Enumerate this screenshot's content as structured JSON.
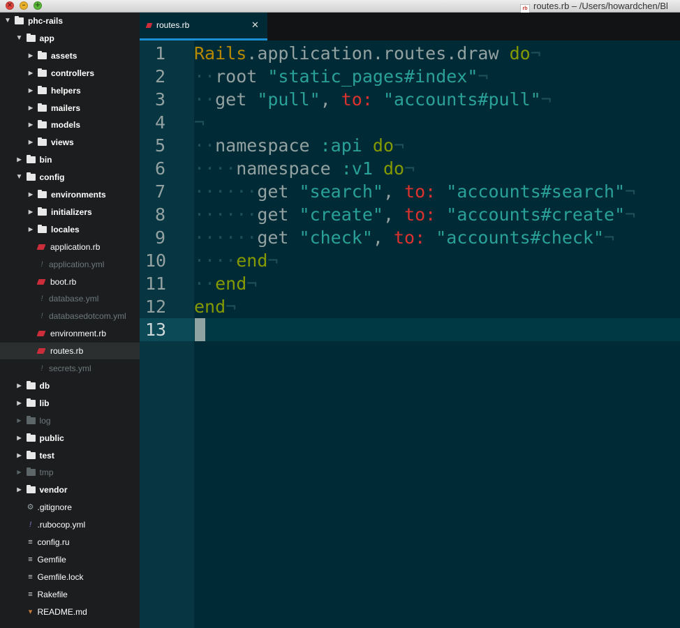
{
  "window": {
    "title": "routes.rb – /Users/howardchen/Bl",
    "title_icon": "rb"
  },
  "sidebar": {
    "items": [
      {
        "label": "phc-rails",
        "depth": 0,
        "kind": "dir",
        "expanded": true
      },
      {
        "label": "app",
        "depth": 1,
        "kind": "dir",
        "expanded": true
      },
      {
        "label": "assets",
        "depth": 2,
        "kind": "dir",
        "expanded": false
      },
      {
        "label": "controllers",
        "depth": 2,
        "kind": "dir",
        "expanded": false
      },
      {
        "label": "helpers",
        "depth": 2,
        "kind": "dir",
        "expanded": false
      },
      {
        "label": "mailers",
        "depth": 2,
        "kind": "dir",
        "expanded": false
      },
      {
        "label": "models",
        "depth": 2,
        "kind": "dir",
        "expanded": false
      },
      {
        "label": "views",
        "depth": 2,
        "kind": "dir",
        "expanded": false
      },
      {
        "label": "bin",
        "depth": 1,
        "kind": "dir",
        "expanded": false
      },
      {
        "label": "config",
        "depth": 1,
        "kind": "dir",
        "expanded": true
      },
      {
        "label": "environments",
        "depth": 2,
        "kind": "dir",
        "expanded": false
      },
      {
        "label": "initializers",
        "depth": 2,
        "kind": "dir",
        "expanded": false
      },
      {
        "label": "locales",
        "depth": 2,
        "kind": "dir",
        "expanded": false
      },
      {
        "label": "application.rb",
        "depth": 2,
        "kind": "ruby"
      },
      {
        "label": "application.yml",
        "depth": 2,
        "kind": "yml",
        "dim": true
      },
      {
        "label": "boot.rb",
        "depth": 2,
        "kind": "ruby"
      },
      {
        "label": "database.yml",
        "depth": 2,
        "kind": "yml",
        "dim": true
      },
      {
        "label": "databasedotcom.yml",
        "depth": 2,
        "kind": "yml",
        "dim": true
      },
      {
        "label": "environment.rb",
        "depth": 2,
        "kind": "ruby"
      },
      {
        "label": "routes.rb",
        "depth": 2,
        "kind": "ruby",
        "selected": true
      },
      {
        "label": "secrets.yml",
        "depth": 2,
        "kind": "yml",
        "dim": true
      },
      {
        "label": "db",
        "depth": 1,
        "kind": "dir",
        "expanded": false
      },
      {
        "label": "lib",
        "depth": 1,
        "kind": "dir",
        "expanded": false
      },
      {
        "label": "log",
        "depth": 1,
        "kind": "dir",
        "expanded": false,
        "dim": true
      },
      {
        "label": "public",
        "depth": 1,
        "kind": "dir",
        "expanded": false
      },
      {
        "label": "test",
        "depth": 1,
        "kind": "dir",
        "expanded": false
      },
      {
        "label": "tmp",
        "depth": 1,
        "kind": "dir",
        "expanded": false,
        "dim": true
      },
      {
        "label": "vendor",
        "depth": 1,
        "kind": "dir",
        "expanded": false
      },
      {
        "label": ".gitignore",
        "depth": 1,
        "kind": "gear"
      },
      {
        "label": ".rubocop.yml",
        "depth": 1,
        "kind": "yml-bright"
      },
      {
        "label": "config.ru",
        "depth": 1,
        "kind": "text"
      },
      {
        "label": "Gemfile",
        "depth": 1,
        "kind": "text"
      },
      {
        "label": "Gemfile.lock",
        "depth": 1,
        "kind": "text"
      },
      {
        "label": "Rakefile",
        "depth": 1,
        "kind": "text"
      },
      {
        "label": "README.md",
        "depth": 1,
        "kind": "markdown"
      }
    ]
  },
  "tabs": [
    {
      "label": "routes.rb",
      "active": true
    }
  ],
  "editor": {
    "current_line": 13,
    "lines": [
      {
        "n": "1",
        "indent": 0,
        "tokens": [
          {
            "t": "Rails",
            "c": "const"
          },
          {
            "t": ".application.routes.draw ",
            "c": "plain"
          },
          {
            "t": "do",
            "c": "kw"
          }
        ]
      },
      {
        "n": "2",
        "indent": 1,
        "tokens": [
          {
            "t": "root ",
            "c": "plain"
          },
          {
            "t": "\"static_pages#index\"",
            "c": "str"
          }
        ]
      },
      {
        "n": "3",
        "indent": 1,
        "tokens": [
          {
            "t": "get ",
            "c": "plain"
          },
          {
            "t": "\"pull\"",
            "c": "str"
          },
          {
            "t": ", ",
            "c": "plain"
          },
          {
            "t": "to:",
            "c": "key"
          },
          {
            "t": " ",
            "c": "plain"
          },
          {
            "t": "\"accounts#pull\"",
            "c": "str"
          }
        ]
      },
      {
        "n": "4",
        "indent": 0,
        "tokens": []
      },
      {
        "n": "5",
        "indent": 1,
        "tokens": [
          {
            "t": "namespace ",
            "c": "plain"
          },
          {
            "t": ":api",
            "c": "sym"
          },
          {
            "t": " ",
            "c": "plain"
          },
          {
            "t": "do",
            "c": "kw"
          }
        ]
      },
      {
        "n": "6",
        "indent": 2,
        "tokens": [
          {
            "t": "namespace ",
            "c": "plain"
          },
          {
            "t": ":v1",
            "c": "sym"
          },
          {
            "t": " ",
            "c": "plain"
          },
          {
            "t": "do",
            "c": "kw"
          }
        ]
      },
      {
        "n": "7",
        "indent": 3,
        "tokens": [
          {
            "t": "get ",
            "c": "plain"
          },
          {
            "t": "\"search\"",
            "c": "str"
          },
          {
            "t": ", ",
            "c": "plain"
          },
          {
            "t": "to:",
            "c": "key"
          },
          {
            "t": " ",
            "c": "plain"
          },
          {
            "t": "\"accounts#search\"",
            "c": "str"
          }
        ]
      },
      {
        "n": "8",
        "indent": 3,
        "tokens": [
          {
            "t": "get ",
            "c": "plain"
          },
          {
            "t": "\"create\"",
            "c": "str"
          },
          {
            "t": ", ",
            "c": "plain"
          },
          {
            "t": "to:",
            "c": "key"
          },
          {
            "t": " ",
            "c": "plain"
          },
          {
            "t": "\"accounts#create\"",
            "c": "str"
          }
        ]
      },
      {
        "n": "9",
        "indent": 3,
        "tokens": [
          {
            "t": "get ",
            "c": "plain"
          },
          {
            "t": "\"check\"",
            "c": "str"
          },
          {
            "t": ", ",
            "c": "plain"
          },
          {
            "t": "to:",
            "c": "key"
          },
          {
            "t": " ",
            "c": "plain"
          },
          {
            "t": "\"accounts#check\"",
            "c": "str"
          }
        ]
      },
      {
        "n": "10",
        "indent": 2,
        "tokens": [
          {
            "t": "end",
            "c": "kw"
          }
        ]
      },
      {
        "n": "11",
        "indent": 1,
        "tokens": [
          {
            "t": "end",
            "c": "kw"
          }
        ]
      },
      {
        "n": "12",
        "indent": 0,
        "tokens": [
          {
            "t": "end",
            "c": "kw"
          }
        ]
      },
      {
        "n": "13",
        "indent": 0,
        "tokens": [],
        "noeol": true
      }
    ]
  },
  "colors": {
    "background": "#002b36",
    "gutter": "#073642",
    "sidebar": "#1b1d1e",
    "tab_accent": "#1a8fd1",
    "constant": "#b58900",
    "keyword": "#859900",
    "string": "#2aa198",
    "key": "#dc322f"
  }
}
